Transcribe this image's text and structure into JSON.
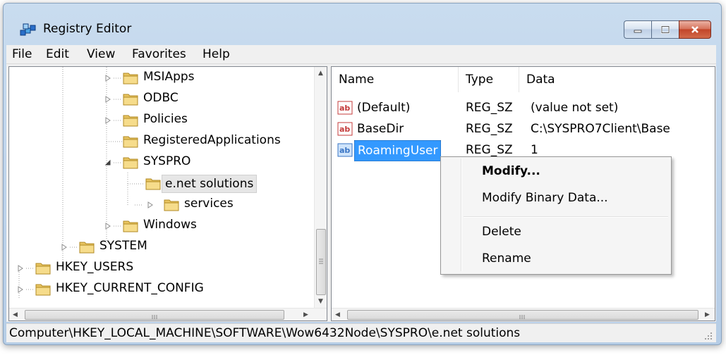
{
  "window": {
    "title": "Registry Editor"
  },
  "menu": [
    "File",
    "Edit",
    "View",
    "Favorites",
    "Help"
  ],
  "tree": {
    "items": [
      {
        "label": "MSIApps",
        "expandable": true,
        "selected": false
      },
      {
        "label": "ODBC",
        "expandable": true,
        "selected": false
      },
      {
        "label": "Policies",
        "expandable": true,
        "selected": false
      },
      {
        "label": "RegisteredApplications",
        "expandable": false,
        "selected": false
      },
      {
        "label": "SYSPRO",
        "expandable": true,
        "expanded": true,
        "selected": false
      },
      {
        "label": "e.net solutions",
        "expandable": false,
        "selected": true
      },
      {
        "label": "services",
        "expandable": true,
        "selected": false
      },
      {
        "label": "Windows",
        "expandable": true,
        "selected": false
      },
      {
        "label": "SYSTEM",
        "expandable": true,
        "selected": false
      },
      {
        "label": "HKEY_USERS",
        "expandable": true,
        "selected": false
      },
      {
        "label": "HKEY_CURRENT_CONFIG",
        "expandable": true,
        "selected": false
      }
    ]
  },
  "list": {
    "columns": [
      "Name",
      "Type",
      "Data"
    ],
    "rows": [
      {
        "name": "(Default)",
        "type": "REG_SZ",
        "data": "(value not set)",
        "icon": "string-value-icon"
      },
      {
        "name": "BaseDir",
        "type": "REG_SZ",
        "data": "C:\\SYSPRO7Client\\Base",
        "icon": "string-value-icon"
      },
      {
        "name": "RoamingUser",
        "type": "REG_SZ",
        "data": "1",
        "icon": "string-value-icon",
        "selected": true
      }
    ]
  },
  "context_menu": {
    "items": [
      "Modify...",
      "Modify Binary Data...",
      "Delete",
      "Rename"
    ],
    "default_item": "Modify..."
  },
  "status": {
    "path": "Computer\\HKEY_LOCAL_MACHINE\\SOFTWARE\\Wow6432Node\\SYSPRO\\e.net solutions"
  },
  "colors": {
    "selection": "#3399ff",
    "titlebar": "#bcd2ea",
    "close_button": "#c2462a"
  }
}
